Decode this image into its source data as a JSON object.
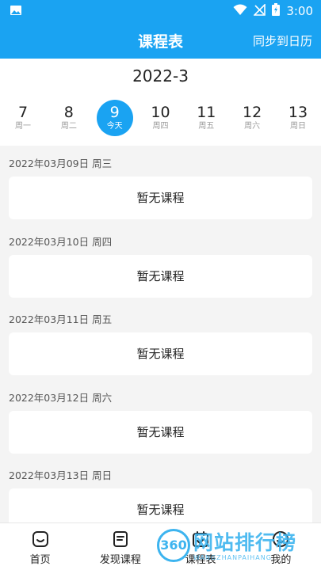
{
  "status_bar": {
    "time": "3:00"
  },
  "header": {
    "title": "课程表",
    "sync_label": "同步到日历"
  },
  "calendar": {
    "month": "2022-3",
    "days": [
      {
        "num": "7",
        "label": "周一"
      },
      {
        "num": "8",
        "label": "周二"
      },
      {
        "num": "9",
        "label": "今天"
      },
      {
        "num": "10",
        "label": "周四"
      },
      {
        "num": "11",
        "label": "周五"
      },
      {
        "num": "12",
        "label": "周六"
      },
      {
        "num": "13",
        "label": "周日"
      }
    ]
  },
  "schedule": [
    {
      "date": "2022年03月09日 周三",
      "empty_text": "暂无课程"
    },
    {
      "date": "2022年03月10日 周四",
      "empty_text": "暂无课程"
    },
    {
      "date": "2022年03月11日 周五",
      "empty_text": "暂无课程"
    },
    {
      "date": "2022年03月12日 周六",
      "empty_text": "暂无课程"
    },
    {
      "date": "2022年03月13日 周日",
      "empty_text": "暂无课程"
    }
  ],
  "tabs": [
    {
      "label": "首页",
      "icon": "home-icon"
    },
    {
      "label": "发现课程",
      "icon": "discover-icon"
    },
    {
      "label": "课程表",
      "icon": "calendar-icon"
    },
    {
      "label": "我的",
      "icon": "profile-icon"
    }
  ],
  "watermark": {
    "badge": "360",
    "text": "网站排行榜",
    "sub": "WANGZHANPAIHANG"
  },
  "colors": {
    "accent": "#1aa3f2",
    "watermark": "#3db4ef",
    "background": "#f4f4f4"
  }
}
